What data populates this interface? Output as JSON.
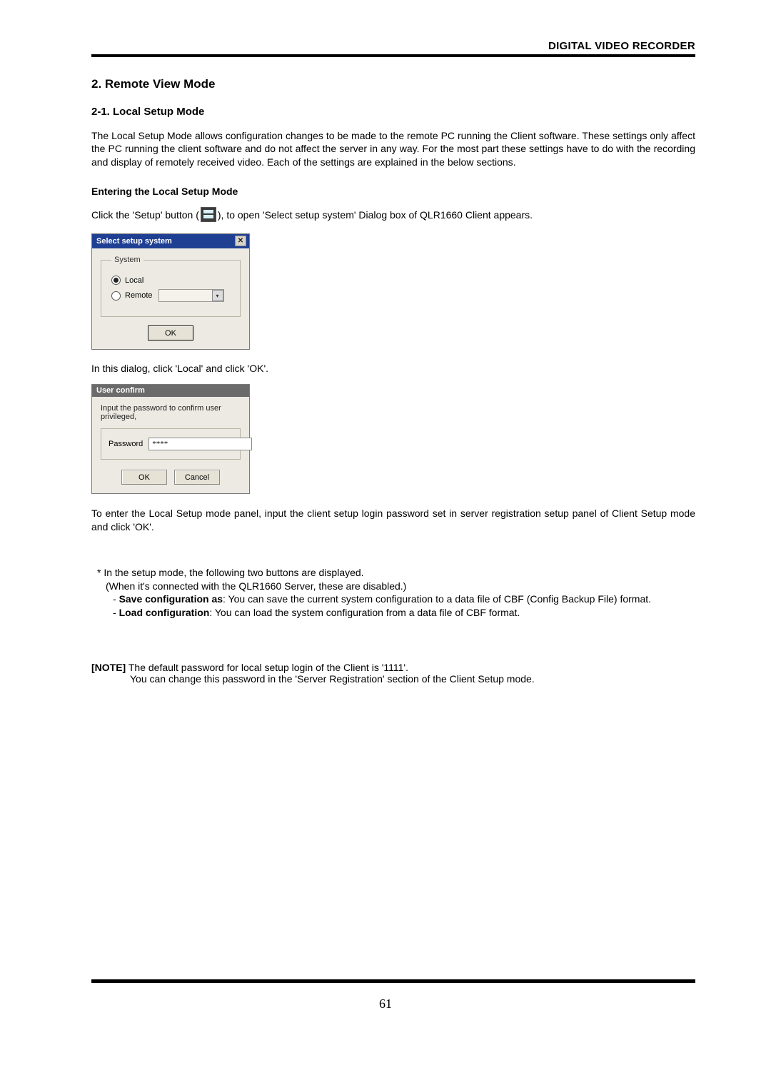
{
  "header": {
    "title": "DIGITAL VIDEO RECORDER"
  },
  "section": {
    "h2": "2.  Remote View Mode",
    "h3": "2-1. Local Setup Mode",
    "p1": "The Local Setup Mode allows configuration changes to be made to the remote PC running the Client software. These settings only affect the PC running the client software and do not affect the server in any way. For the most part these settings have to do with the recording and display of remotely received video. Each of the settings are explained in the below sections.",
    "h4": "Entering the Local Setup Mode",
    "click_pre": "Click the 'Setup' button (",
    "click_post": "), to open 'Select setup system' Dialog box of QLR1660 Client appears."
  },
  "dialog1": {
    "title": "Select setup system",
    "close": "✕",
    "legend": "System",
    "opt_local": "Local",
    "opt_remote": "Remote",
    "ok": "OK"
  },
  "mid_text": "In this dialog, click 'Local' and click 'OK'.",
  "dialog2": {
    "title": "User confirm",
    "msg": "Input the password to confirm user privileged,",
    "pwd_label": "Password",
    "pwd_value": "****",
    "ok": "OK",
    "cancel": "Cancel"
  },
  "p2": "To enter the Local Setup mode panel, input the client setup login password set in server registration setup panel of Client Setup mode and click 'OK'.",
  "bullets": {
    "l1": "* In the setup mode, the following two buttons are displayed.",
    "l2": "(When it's connected with the QLR1660 Server, these are disabled.)",
    "l3a": "- ",
    "l3b": "Save configuration as",
    "l3c": ": You can save the current system configuration to a data file of CBF (Config Backup File) format.",
    "l3_cont": "format.",
    "l4a": "- ",
    "l4b": "Load configuration",
    "l4c": ": You can load the system configuration from a data file of CBF format."
  },
  "note": {
    "label": "[NOTE]",
    "l1": " The default password for local setup login of the Client is '1111'.",
    "l2": "You can change this password in the 'Server Registration' section of the Client Setup mode."
  },
  "page_number": "61"
}
